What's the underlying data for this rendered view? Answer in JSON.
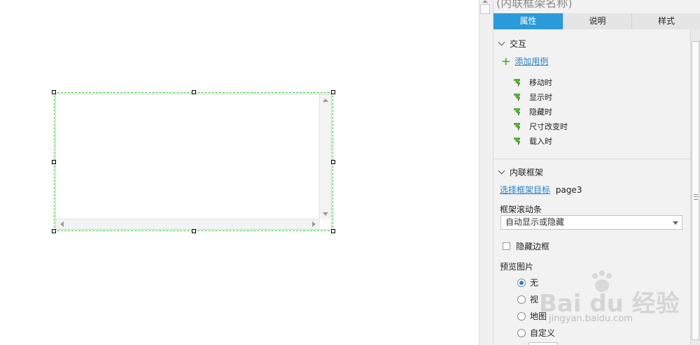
{
  "panel": {
    "title": "(内联框架名称)",
    "tabs": [
      {
        "label": "属性",
        "active": true
      },
      {
        "label": "说明",
        "active": false
      },
      {
        "label": "样式",
        "active": false
      }
    ],
    "interaction": {
      "header": "交互",
      "add_case": "添加用例",
      "events": [
        "移动时",
        "显示时",
        "隐藏时",
        "尺寸改变时",
        "载入时"
      ]
    },
    "inline_frame": {
      "header": "内联框架",
      "select_target_link": "选择框架目标",
      "target_value": "page3",
      "scrollbar_label": "框架滚动条",
      "scrollbar_value": "自动显示或隐藏",
      "hide_border_label": "隐藏边框",
      "hide_border_checked": false,
      "preview_label": "预览图片",
      "preview_options": [
        {
          "label": "无",
          "checked": true
        },
        {
          "label": "视",
          "checked": false
        },
        {
          "label": "地图",
          "checked": false
        },
        {
          "label": "自定义",
          "checked": false
        }
      ]
    }
  },
  "watermark": {
    "brand": "Bai du 经验",
    "url": "jingyan.baidu.com"
  },
  "colors": {
    "accent": "#2a9bd8",
    "selection": "#39c339",
    "event_icon": "#5ea83a",
    "link": "#2a82c6"
  }
}
